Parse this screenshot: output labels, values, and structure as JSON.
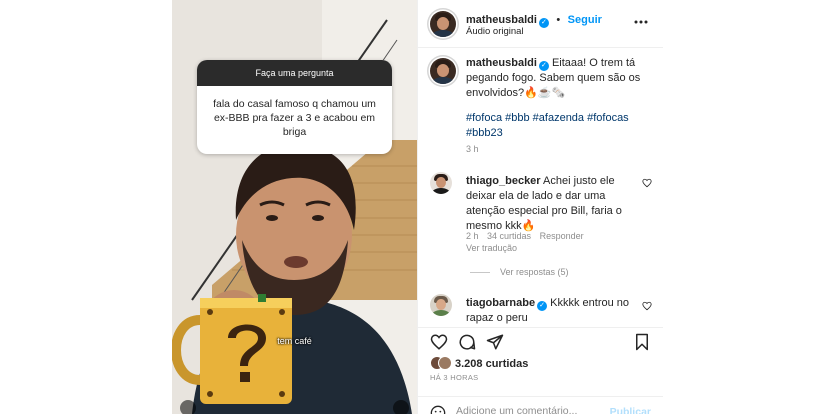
{
  "media": {
    "question_header": "Faça uma pergunta",
    "question_text": "fala do casal famoso q chamou um ex-BBB pra fazer a 3 e acabou em briga",
    "caption": "tem café"
  },
  "header": {
    "username": "matheusbaldi",
    "follow_label": "Seguir",
    "audio_label": "Áudio original"
  },
  "post": {
    "username": "matheusbaldi",
    "caption": "Eitaaa! O trem tá pegando fogo. Sabem quem são os envolvidos?🔥☕🗞️",
    "hashtags_line1": "#fofoca #bbb #afazenda #fofocas",
    "hashtags_line2": "#bbb23",
    "time": "3 h"
  },
  "comments": [
    {
      "username": "thiago_becker",
      "text": "Achei justo ele deixar ela de lado e dar uma atenção especial pro Bill, faria o mesmo kkk🔥",
      "time": "2 h",
      "likes": "34 curtidas",
      "reply_label": "Responder",
      "translate_label": "Ver tradução",
      "view_replies": "Ver respostas (5)"
    },
    {
      "username": "tiagobarnabe",
      "text": "Kkkkk entrou no rapaz o peru"
    }
  ],
  "footer": {
    "likes": "3.208 curtidas",
    "time_ago": "HÁ 3 HORAS",
    "comment_placeholder": "Adicione um comentário...",
    "publish_label": "Publicar"
  },
  "colors": {
    "accent": "#0095f6",
    "hashtag": "#00376b",
    "muted": "#8e8e8e"
  },
  "icons": [
    "more-icon",
    "heart-icon",
    "comment-icon",
    "share-icon",
    "bookmark-icon",
    "emoji-icon",
    "verified-icon"
  ]
}
